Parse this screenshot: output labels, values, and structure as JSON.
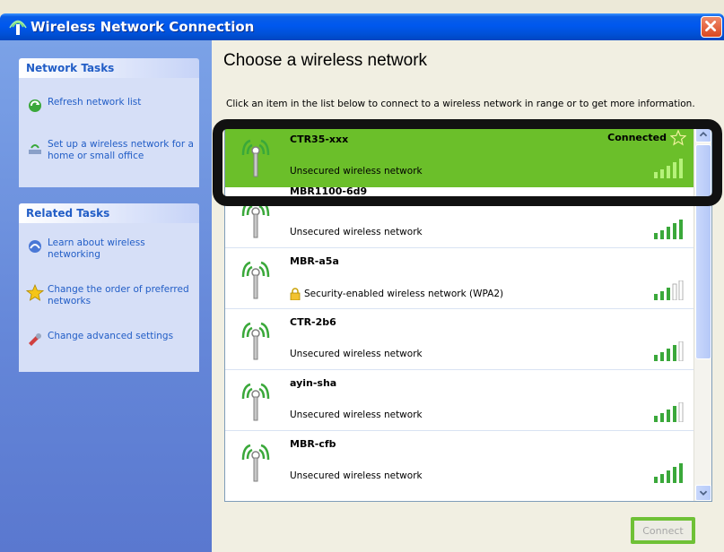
{
  "window": {
    "title": "Wireless Network Connection"
  },
  "left_pane": {
    "network_tasks": {
      "header": "Network Tasks",
      "items": [
        {
          "label": "Refresh network list",
          "icon": "refresh-icon"
        },
        {
          "label": "Set up a wireless network for a home or small office",
          "icon": "setup-network-icon"
        }
      ]
    },
    "related_tasks": {
      "header": "Related Tasks",
      "items": [
        {
          "label": "Learn about wireless networking",
          "icon": "help-icon"
        },
        {
          "label": "Change the order of preferred networks",
          "icon": "star-icon"
        },
        {
          "label": "Change advanced settings",
          "icon": "settings-icon"
        }
      ]
    }
  },
  "content": {
    "heading": "Choose a wireless network",
    "description": "Click an item in the list below to connect to a wireless network in range or to get more information.",
    "networks": [
      {
        "name": "CTR35-xxx",
        "status": "Unsecured wireless network",
        "connection": "Connected",
        "selected": true,
        "signal_bars": 5
      },
      {
        "name": "MBR1100-6d9",
        "status": "Unsecured wireless network",
        "connection": "",
        "selected": false,
        "signal_bars": 5
      },
      {
        "name": "MBR-a5a",
        "status": "Security-enabled wireless network (WPA2)",
        "connection": "",
        "selected": false,
        "signal_bars": 3,
        "secured": true
      },
      {
        "name": "CTR-2b6",
        "status": "Unsecured wireless network",
        "connection": "",
        "selected": false,
        "signal_bars": 4
      },
      {
        "name": "ayin-sha",
        "status": "Unsecured wireless network",
        "connection": "",
        "selected": false,
        "signal_bars": 4
      },
      {
        "name": "MBR-cfb",
        "status": "Unsecured wireless network",
        "connection": "",
        "selected": false,
        "signal_bars": 5
      }
    ],
    "connect_label": "Connect"
  },
  "colors": {
    "selected_row": "#6bbf2a",
    "highlight_border": "#111111",
    "title_bar": "#0058ee",
    "task_link": "#215dc6"
  }
}
